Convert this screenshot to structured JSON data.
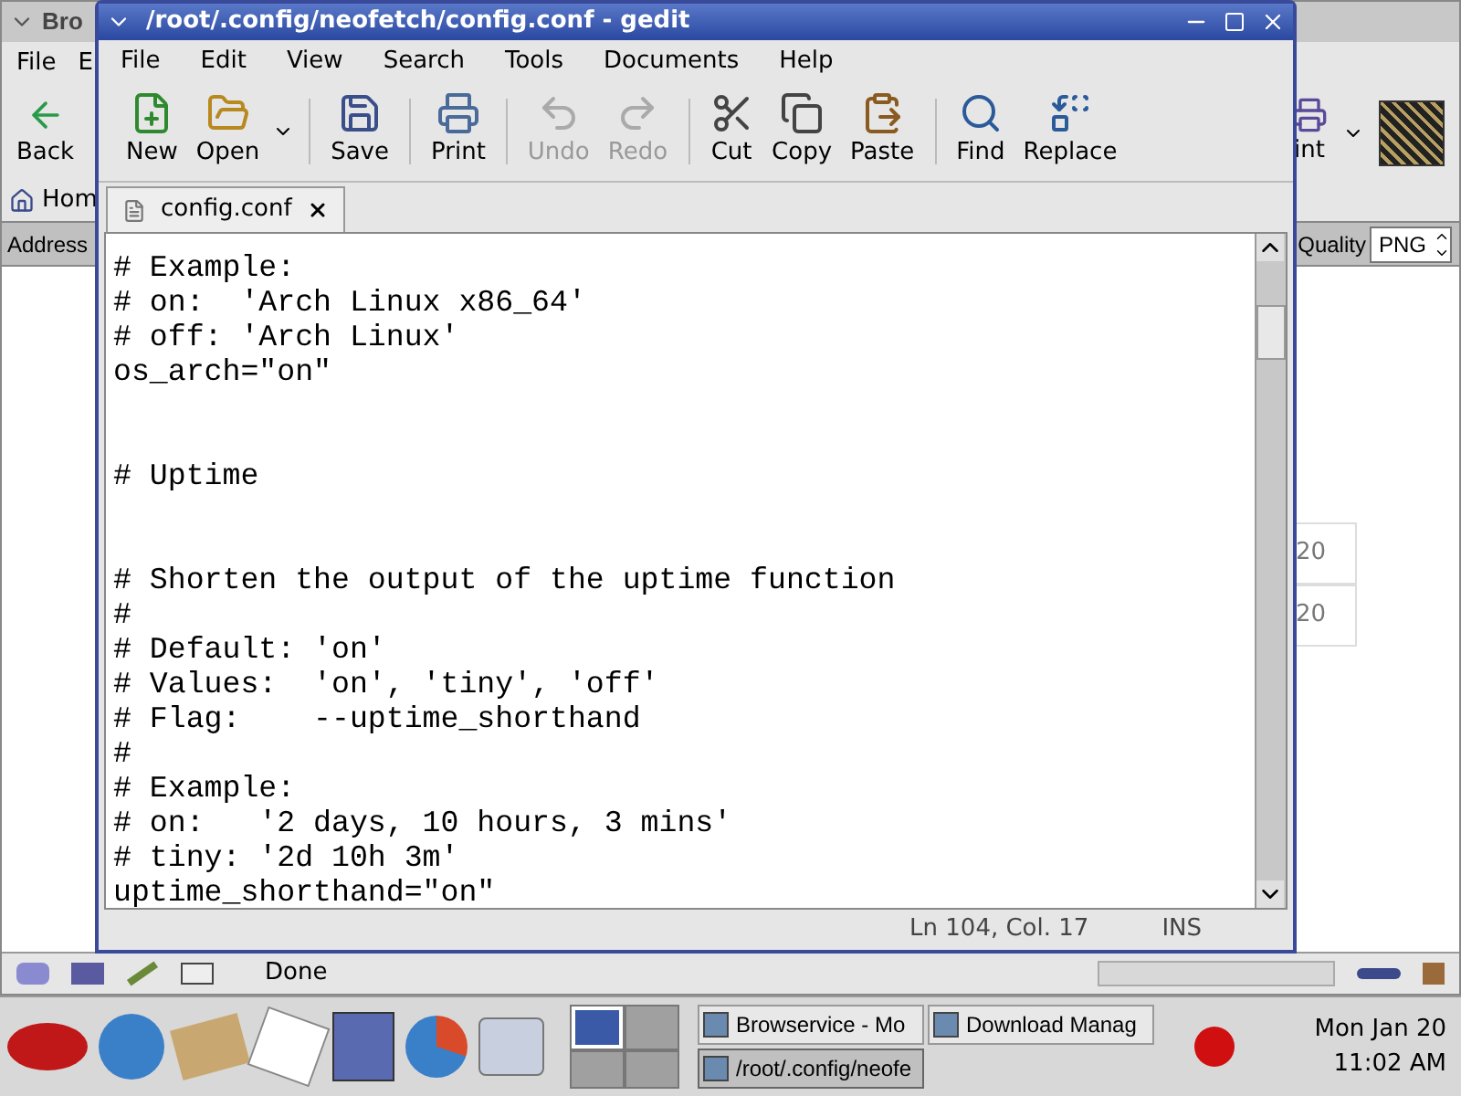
{
  "browser": {
    "title": "Bro",
    "menu": [
      "File",
      "E"
    ],
    "back": "Back",
    "print": "int",
    "home": "Hom",
    "address_label": "Address",
    "quality_label": "Quality",
    "quality_value": "PNG",
    "cells": [
      "20",
      "20"
    ],
    "status": "Done",
    "progress": {
      "level": 0
    }
  },
  "editor": {
    "title": "/root/.config/neofetch/config.conf - gedit",
    "menu": [
      "File",
      "Edit",
      "View",
      "Search",
      "Tools",
      "Documents",
      "Help"
    ],
    "toolbar": [
      {
        "kind": "new",
        "label": "New",
        "disabled": false
      },
      {
        "kind": "open",
        "label": "Open",
        "disabled": false
      },
      {
        "kind": "save",
        "label": "Save",
        "disabled": false
      },
      {
        "kind": "print",
        "label": "Print",
        "disabled": false
      },
      {
        "kind": "undo",
        "label": "Undo",
        "disabled": true
      },
      {
        "kind": "redo",
        "label": "Redo",
        "disabled": true
      },
      {
        "kind": "cut",
        "label": "Cut",
        "disabled": false
      },
      {
        "kind": "copy",
        "label": "Copy",
        "disabled": false
      },
      {
        "kind": "paste",
        "label": "Paste",
        "disabled": false
      },
      {
        "kind": "find",
        "label": "Find",
        "disabled": false
      },
      {
        "kind": "replace",
        "label": "Replace",
        "disabled": false
      }
    ],
    "tabs": [
      {
        "label": "config.conf",
        "selected": true
      }
    ],
    "blocks": [
      {
        "lines": [
          "# Example:",
          "# on:  'Arch Linux x86_64'",
          "# off: 'Arch Linux'",
          "os_arch=\"on\""
        ]
      },
      {
        "lines": [
          "# Uptime"
        ]
      },
      {
        "lines": [
          "# Shorten the output of the uptime function",
          "#",
          "# Default: 'on'",
          "# Values:  'on', 'tiny', 'off'",
          "# Flag:    --uptime_shorthand",
          "#",
          "# Example:",
          "# on:   '2 days, 10 hours, 3 mins'",
          "# tiny: '2d 10h 3m'",
          "uptime_shorthand=\"on\""
        ]
      }
    ],
    "position": "Ln 104, Col. 17",
    "mode": "INS"
  },
  "taskbar": {
    "tasks": [
      {
        "label": "Browservice - Mo",
        "selected": false
      },
      {
        "label": "Download Manag",
        "selected": false
      },
      {
        "label": "/root/.config/neofe",
        "selected": true
      }
    ],
    "workspaces": [
      {
        "selected": true
      },
      {
        "selected": false
      },
      {
        "selected": false
      },
      {
        "selected": false
      }
    ],
    "day": "Mon Jan 20",
    "time": "11:02 AM"
  }
}
